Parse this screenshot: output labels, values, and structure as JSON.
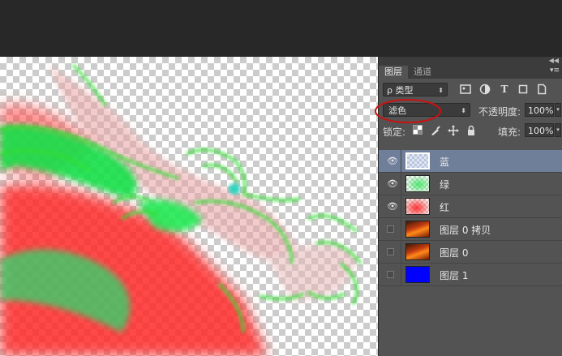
{
  "panel": {
    "collapse_glyph": "◀◀",
    "menu_glyph": "▾≡",
    "tabs": [
      {
        "label": "图层"
      },
      {
        "label": "通道"
      }
    ],
    "filter": {
      "label": "ρ 类型",
      "arrow": "⬍"
    },
    "filter_icons": [
      "image-filter-icon",
      "adjustment-filter-icon",
      "type-filter-icon",
      "shape-filter-icon",
      "smart-object-filter-icon"
    ],
    "blend_mode": {
      "value": "滤色",
      "arrow": "⬍"
    },
    "opacity": {
      "label": "不透明度:",
      "value": "100%"
    },
    "lock": {
      "label": "锁定:"
    },
    "fill": {
      "label": "填充:",
      "value": "100%"
    },
    "layers": [
      {
        "name": "蓝",
        "visible": true,
        "selected": true,
        "thumb": "transparent-blue"
      },
      {
        "name": "绿",
        "visible": true,
        "selected": false,
        "thumb": "transparent-green"
      },
      {
        "name": "红",
        "visible": true,
        "selected": false,
        "thumb": "transparent-red"
      },
      {
        "name": "图层 0 拷贝",
        "visible": false,
        "selected": false,
        "thumb": "photo"
      },
      {
        "name": "图层 0",
        "visible": false,
        "selected": false,
        "thumb": "photo"
      },
      {
        "name": "图层 1",
        "visible": false,
        "selected": false,
        "thumb": "solid-blue"
      }
    ]
  },
  "colors": {
    "annotation_circle": "#cc1111",
    "selected_layer": "#6f7f9a",
    "layer_1_fill": "#0000ff"
  }
}
